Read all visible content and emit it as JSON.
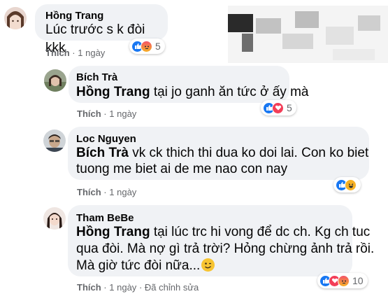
{
  "comments": [
    {
      "author": "Hồng Trang",
      "text": "Lúc trước s k đòi kkk",
      "like_label": "Thích",
      "time": "1 ngày",
      "reaction_count": "5",
      "reactions": [
        "like-icon",
        "angry-icon"
      ]
    },
    {
      "author": "Bích Trà",
      "mention": "Hồng Trang",
      "text": " tại jo ganh ăn tức ở ấy mà",
      "like_label": "Thích",
      "time": "1 ngày",
      "reaction_count": "5",
      "reactions": [
        "like-icon",
        "love-icon"
      ]
    },
    {
      "author": "Loc Nguyen",
      "mention": "Bích Trà",
      "text_line1": " vk ck thich thi dua ko doi lai. Con ko biet",
      "text_line2": "tuong me biet ai de me nao con nay",
      "like_label": "Thích",
      "time": "1 ngày",
      "reaction_count": "",
      "reactions": [
        "like-icon",
        "haha-icon"
      ]
    },
    {
      "author": "Tham BeBe",
      "mention": "Hồng Trang",
      "text_line1": " tại lúc trc hi vong để dc ch. Kg ch tuc",
      "text_line2": "qua đòi. Mà nợ gì trả trời? Hỏng chừng ảnh trả rồi.",
      "text_line3": "Mà giờ tức đòi nữa...",
      "like_label": "Thích",
      "time": "1 ngày",
      "separator": "·",
      "edited": "Đã chỉnh sửa",
      "reaction_count": "10",
      "reactions": [
        "like-icon",
        "love-icon",
        "angry-icon"
      ]
    }
  ],
  "meta_separator": "·",
  "colors": {
    "bubble": "#f0f2f5",
    "meta": "#65676b",
    "like": "#1877f2",
    "love": "#f33e58",
    "haha": "#f7b125"
  }
}
